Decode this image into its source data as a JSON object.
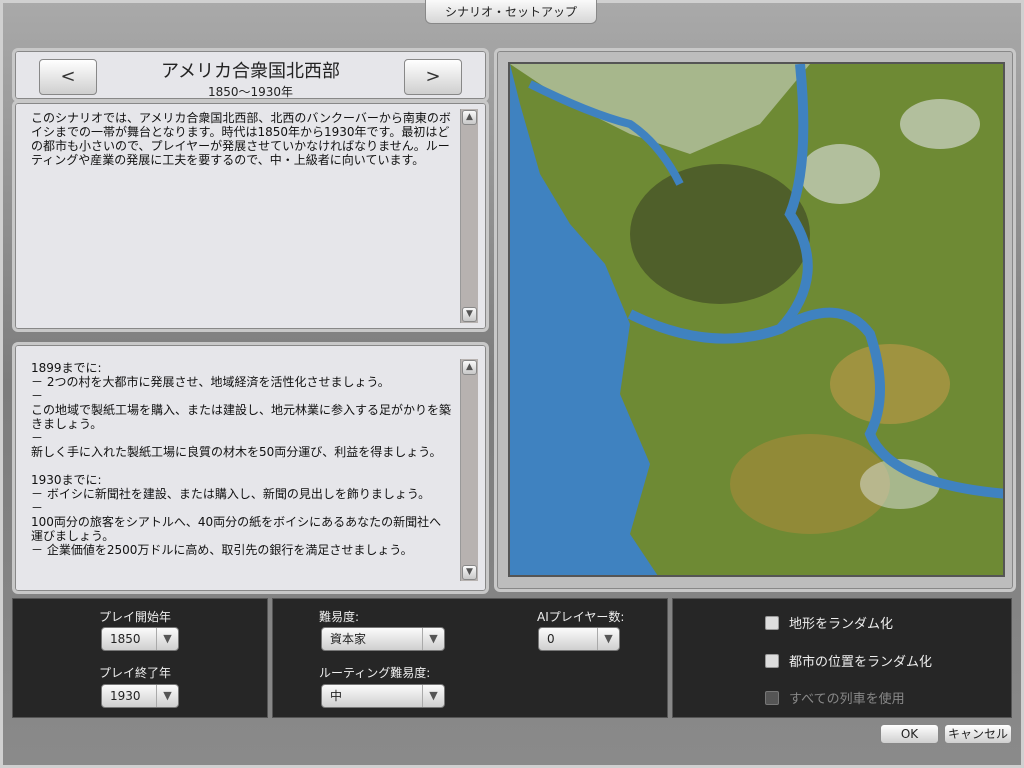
{
  "window": {
    "title": "シナリオ・セットアップ"
  },
  "scenario": {
    "name": "アメリカ合衆国北西部",
    "years": "1850〜1930年",
    "prev": "<",
    "next": ">",
    "description": "このシナリオでは、アメリカ合衆国北西部、北西のバンクーバーから南東のボイシまでの一帯が舞台となります。時代は1850年から1930年です。最初はどの都市も小さいので、プレイヤーが発展させていかなければなりません。ルーティングや産業の発展に工夫を要するので、中・上級者に向いています。",
    "objectives": "1899までに:\n－ 2つの村を大都市に発展させ、地域経済を活性化させましょう。\n－\nこの地域で製紙工場を購入、または建設し、地元林業に参入する足がかりを築きましょう。\n－\n新しく手に入れた製紙工場に良質の材木を50両分運び、利益を得ましょう。\n\n1930までに:\n－ ボイシに新聞社を建設、または購入し、新聞の見出しを飾りましょう。\n－\n100両分の旅客をシアトルへ、40両分の紙をボイシにあるあなたの新聞社へ運びましょう。\n－ 企業価値を2500万ドルに高め、取引先の銀行を満足させましょう。"
  },
  "settings": {
    "start_label": "プレイ開始年",
    "start_value": "1850",
    "end_label": "プレイ終了年",
    "end_value": "1930",
    "difficulty_label": "難易度:",
    "difficulty_value": "資本家",
    "routing_label": "ルーティング難易度:",
    "routing_value": "中",
    "ai_label": "AIプレイヤー数:",
    "ai_value": "0"
  },
  "options": {
    "random_terrain": "地形をランダム化",
    "random_cities": "都市の位置をランダム化",
    "all_trains": "すべての列車を使用"
  },
  "buttons": {
    "ok": "OK",
    "cancel": "キャンセル"
  },
  "icons": {
    "up": "▲",
    "down": "▼",
    "dropdown": "▼"
  }
}
